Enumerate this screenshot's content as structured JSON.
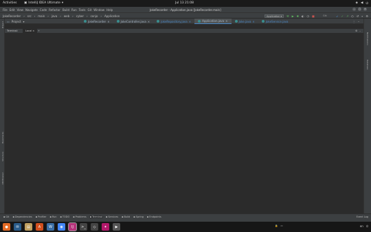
{
  "topbar": {
    "activities": "Activities",
    "app_name": "IntelliJ IDEA Ultimate",
    "clock": "Jul 13  21:08"
  },
  "window": {
    "title": "JokeRecorder - Application.java [JokeRecorder.main]",
    "menu": [
      "File",
      "Edit",
      "View",
      "Navigate",
      "Code",
      "Refactor",
      "Build",
      "Run",
      "Tools",
      "Git",
      "Window",
      "Help"
    ]
  },
  "navbar": {
    "breadcrumbs": [
      "JokeRecorder",
      "src",
      "main",
      "java",
      "web",
      "cyber",
      "conjo",
      "Application"
    ],
    "run_config": "Application",
    "git_label": "Git:"
  },
  "toolwindow": {
    "project_label": "Project"
  },
  "editor_tabs": [
    {
      "label": "JokeRecorder",
      "hl": false,
      "active": false
    },
    {
      "label": "JokeController.java",
      "hl": false,
      "active": false
    },
    {
      "label": "JokeRepository.java",
      "hl": true,
      "active": false
    },
    {
      "label": "Application.java",
      "hl": false,
      "active": true
    },
    {
      "label": "Joke.java",
      "hl": true,
      "active": false
    }
  ],
  "editor_tab_suffix": "JokeService.java",
  "terminal": {
    "label": "Terminal:",
    "tab": "Local",
    "plus": "+"
  },
  "left_stripe": [
    "Project",
    "Bookmarks",
    "Structure",
    "DB Browser"
  ],
  "right_stripe": [
    "Notifications",
    "Database"
  ],
  "toolwindows": [
    {
      "label": "Git",
      "on": false
    },
    {
      "label": "Dependencies",
      "on": false
    },
    {
      "label": "Profiler",
      "on": false
    },
    {
      "label": "Run",
      "on": false
    },
    {
      "label": "TODO",
      "on": false
    },
    {
      "label": "Problems",
      "on": false
    },
    {
      "label": "Terminal",
      "on": true
    },
    {
      "label": "Services",
      "on": false
    },
    {
      "label": "Build",
      "on": false
    },
    {
      "label": "Spring",
      "on": false
    },
    {
      "label": "Endpoints",
      "on": false
    }
  ],
  "status_right": "Event Log",
  "dock_right": [
    "en",
    "⏻"
  ]
}
